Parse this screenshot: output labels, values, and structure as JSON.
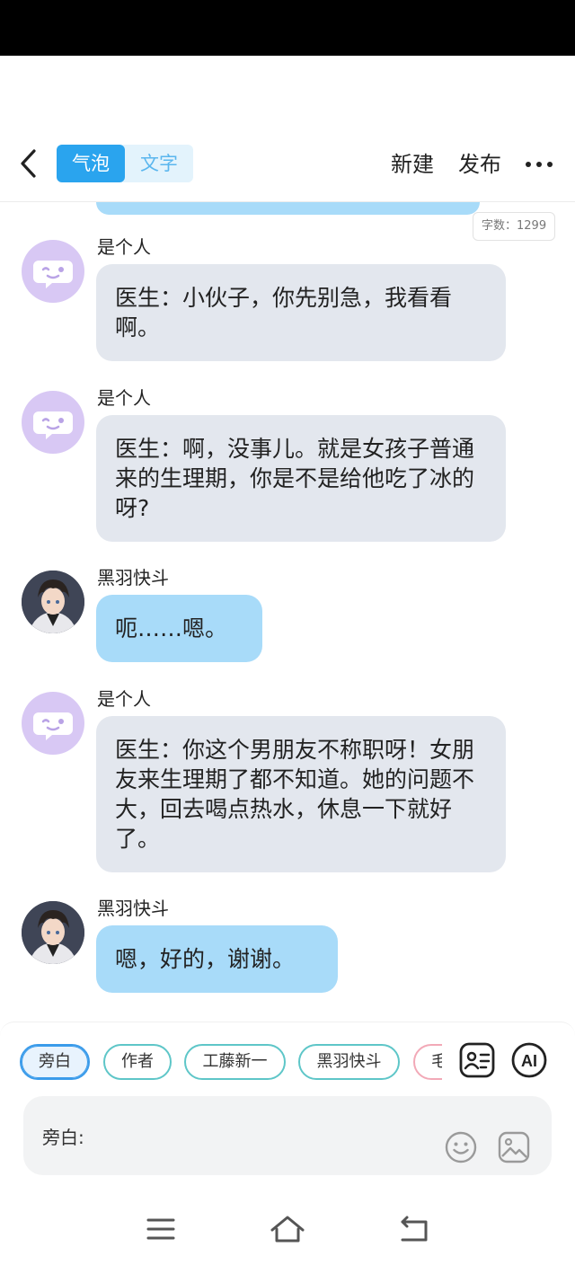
{
  "header": {
    "segment_active": "气泡",
    "segment_inactive": "文字",
    "new_label": "新建",
    "publish_label": "发布"
  },
  "word_count": "字数：1299",
  "messages": [
    {
      "sender": "是个人",
      "text": "医生：小伙子，你先别急，我看看啊。",
      "style": "gray",
      "avatar": "bot-bubble-avatar"
    },
    {
      "sender": "是个人",
      "text": "医生：啊，没事儿。就是女孩子普通来的生理期，你是不是给他吃了冰的呀?",
      "style": "gray",
      "avatar": "bot-bubble-avatar"
    },
    {
      "sender": "黑羽快斗",
      "text": "呃……嗯。",
      "style": "blue",
      "avatar": "anime-character-avatar"
    },
    {
      "sender": "是个人",
      "text": "医生：你这个男朋友不称职呀！女朋友来生理期了都不知道。她的问题不大，回去喝点热水，休息一下就好了。",
      "style": "gray",
      "avatar": "bot-bubble-avatar"
    },
    {
      "sender": "黑羽快斗",
      "text": "嗯，好的，谢谢。",
      "style": "blue",
      "avatar": "anime-character-avatar"
    }
  ],
  "chips": [
    "旁白",
    "作者",
    "工藤新一",
    "黑羽快斗",
    "毛"
  ],
  "ai_label": "AI",
  "input": {
    "prefix": "旁白:"
  },
  "colors": {
    "accent": "#2aa4ee",
    "bubble_blue": "#a8dbf9",
    "bubble_gray": "#e3e7ee",
    "chip_border": "#5ec6c8"
  },
  "icons": {
    "back": "chevron-left-icon",
    "more": "more-dots-icon",
    "role_card": "contact-card-icon",
    "emoji": "smiley-icon",
    "image": "image-icon",
    "nav_menu": "menu-icon",
    "nav_home": "home-icon",
    "nav_back": "return-icon"
  }
}
